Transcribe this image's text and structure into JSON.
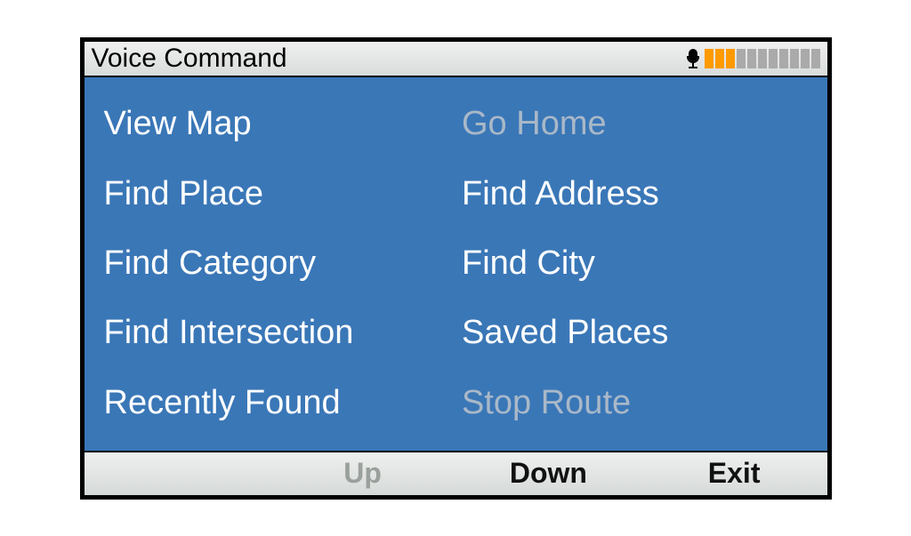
{
  "header": {
    "title": "Voice Command"
  },
  "mic": {
    "active_bars": 3,
    "total_bars": 11
  },
  "commands": {
    "r0c0": "View Map",
    "r0c1": "Go Home",
    "r1c0": "Find Place",
    "r1c1": "Find Address",
    "r2c0": "Find Category",
    "r2c1": "Find City",
    "r3c0": "Find Intersection",
    "r3c1": "Saved Places",
    "r4c0": "Recently Found",
    "r4c1": "Stop Route"
  },
  "footer": {
    "up": "Up",
    "down": "Down",
    "exit": "Exit"
  }
}
